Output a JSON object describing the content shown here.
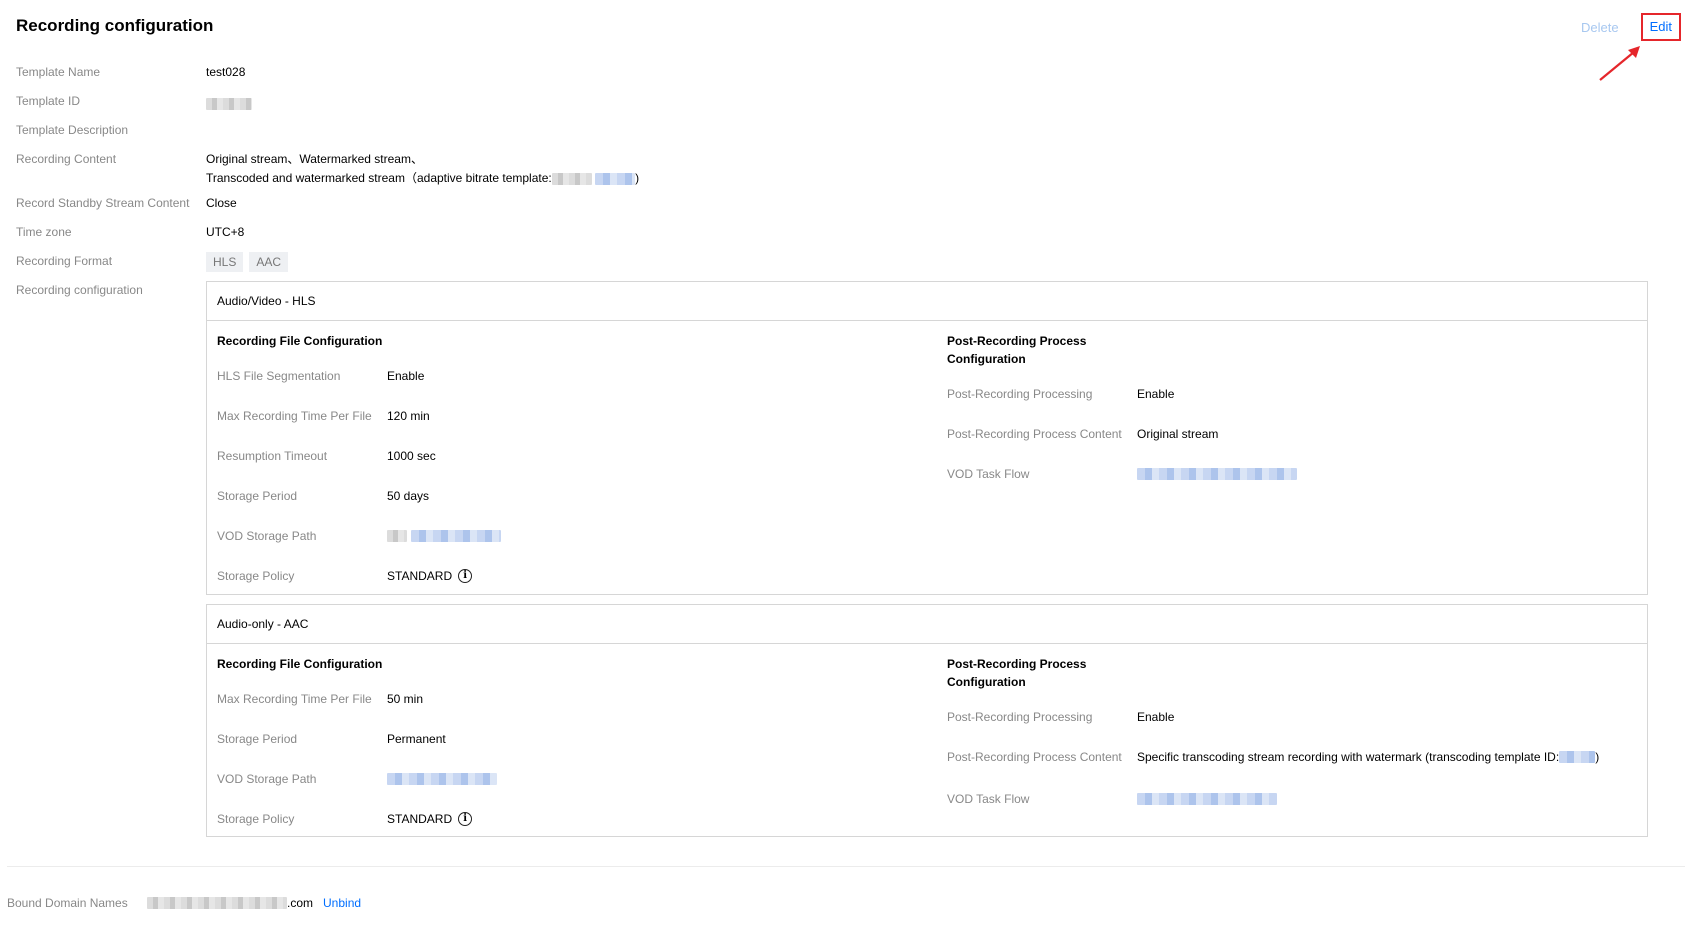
{
  "header": {
    "title": "Recording configuration",
    "delete_label": "Delete",
    "edit_label": "Edit"
  },
  "fields": {
    "template_name": {
      "label": "Template Name",
      "value": "test028"
    },
    "template_id": {
      "label": "Template ID"
    },
    "template_description": {
      "label": "Template Description",
      "value": ""
    },
    "recording_content": {
      "label": "Recording Content",
      "line1": "Original stream、Watermarked stream、",
      "line2_prefix": "Transcoded and watermarked stream（adaptive bitrate template:",
      "line2_suffix": ")"
    },
    "standby": {
      "label": "Record Standby Stream Content",
      "value": "Close"
    },
    "timezone": {
      "label": "Time zone",
      "value": "UTC+8"
    },
    "format": {
      "label": "Recording Format",
      "tags": [
        "HLS",
        "AAC"
      ]
    },
    "recording_configuration": {
      "label": "Recording configuration"
    }
  },
  "hls_card": {
    "title": "Audio/Video - HLS",
    "left_title": "Recording File Configuration",
    "left": [
      {
        "key": "HLS File Segmentation",
        "value": "Enable"
      },
      {
        "key": "Max Recording Time Per File",
        "value": "120 min"
      },
      {
        "key": "Resumption Timeout",
        "value": "1000 sec"
      },
      {
        "key": "Storage Period",
        "value": "50 days"
      },
      {
        "key": "VOD Storage Path",
        "value": ""
      },
      {
        "key": "Storage Policy",
        "value": "STANDARD"
      }
    ],
    "right_title_1": "Post-Recording Process",
    "right_title_2": "Configuration",
    "right": [
      {
        "key": "Post-Recording Processing",
        "value": "Enable"
      },
      {
        "key": "Post-Recording Process Content",
        "value": "Original stream"
      },
      {
        "key": "VOD Task Flow",
        "value": ""
      }
    ]
  },
  "aac_card": {
    "title": "Audio-only - AAC",
    "left_title": "Recording File Configuration",
    "left": [
      {
        "key": "Max Recording Time Per File",
        "value": "50 min"
      },
      {
        "key": "Storage Period",
        "value": "Permanent"
      },
      {
        "key": "VOD Storage Path",
        "value": ""
      },
      {
        "key": "Storage Policy",
        "value": "STANDARD"
      }
    ],
    "right_title_1": "Post-Recording Process",
    "right_title_2": "Configuration",
    "right": [
      {
        "key": "Post-Recording Processing",
        "value": "Enable"
      },
      {
        "key": "Post-Recording Process Content",
        "value_prefix": "Specific transcoding stream recording with watermark (transcoding template ID:",
        "value_suffix": ")"
      },
      {
        "key": "VOD Task Flow",
        "value": ""
      }
    ]
  },
  "bound": {
    "label": "Bound Domain Names",
    "domain_suffix": ".com",
    "unbind_label": "Unbind"
  },
  "info_glyph": "i",
  "colors": {
    "link": "#006eff",
    "highlight_box": "#e5262b",
    "label": "#888888"
  }
}
